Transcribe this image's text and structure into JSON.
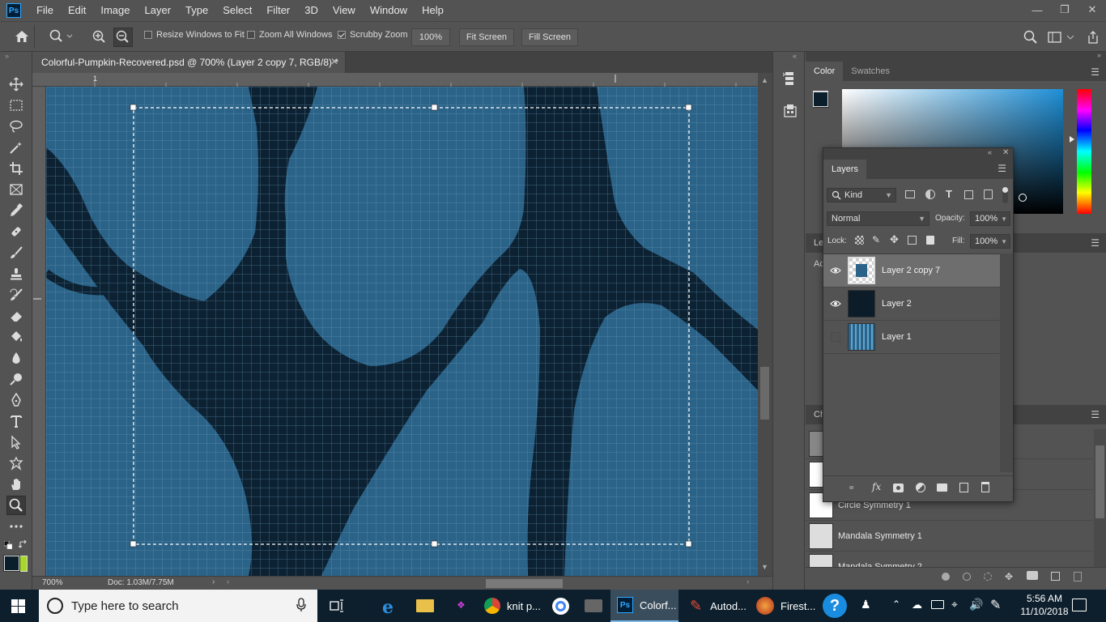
{
  "app": {
    "logo": "Ps"
  },
  "menubar": {
    "items": [
      "File",
      "Edit",
      "Image",
      "Layer",
      "Type",
      "Select",
      "Filter",
      "3D",
      "View",
      "Window",
      "Help"
    ]
  },
  "options": {
    "resize_windows": "Resize Windows to Fit",
    "zoom_all": "Zoom All Windows",
    "scrubby_zoom": "Scrubby Zoom",
    "zoom_value": "100%",
    "fit_screen": "Fit Screen",
    "fill_screen": "Fill Screen",
    "resize_checked": false,
    "zoom_all_checked": false,
    "scrubby_checked": true
  },
  "document": {
    "tab_title": "Colorful-Pumpkin-Recovered.psd @ 700% (Layer 2 copy 7, RGB/8) *",
    "ruler_label": "1",
    "zoom": "700%",
    "doc_info": "Doc: 1.03M/7.75M",
    "canvas_colors": {
      "light": "#2b6388",
      "dark": "#0c2132",
      "grid": "#6b9bb8"
    }
  },
  "color_panel": {
    "tabs": [
      "Color",
      "Swatches"
    ],
    "fg": "#0a1e2c",
    "bg": "#a8d62a"
  },
  "layers_panel": {
    "tab": "Layers",
    "filter_kind": "Kind",
    "blend_mode": "Normal",
    "opacity_label": "Opacity:",
    "opacity": "100%",
    "lock_label": "Lock:",
    "fill_label": "Fill:",
    "fill": "100%",
    "layers": [
      {
        "name": "Layer 2 copy 7",
        "visible": true,
        "selected": true
      },
      {
        "name": "Layer 2",
        "visible": true,
        "selected": false
      },
      {
        "name": "Layer 1",
        "visible": false,
        "selected": false
      }
    ]
  },
  "right_dock": {
    "labels": [
      "Le",
      "Ad",
      "Ch"
    ]
  },
  "history_panel": {
    "items": [
      "Circle Symmetry 1",
      "Mandala Symmetry 1",
      "Mandala Symmetry 2"
    ]
  },
  "taskbar": {
    "search_placeholder": "Type here to search",
    "apps": [
      {
        "label": "knit p..."
      },
      {
        "label": "Colorf..."
      },
      {
        "label": "Autod..."
      },
      {
        "label": "Firest..."
      }
    ],
    "time": "5:56 AM",
    "date": "11/10/2018"
  }
}
